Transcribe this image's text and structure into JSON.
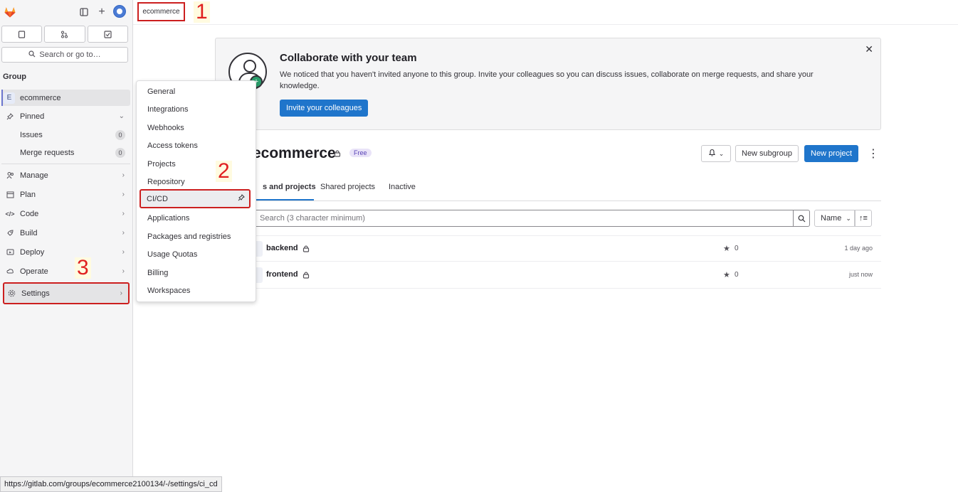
{
  "top": {
    "breadcrumb": "ecommerce",
    "annotations": [
      "1",
      "2",
      "3"
    ]
  },
  "sidebar": {
    "section_label": "Group",
    "search_label": "Search or go to…",
    "group_initial": "E",
    "group_name": "ecommerce",
    "pinned_label": "Pinned",
    "pinned_items": [
      {
        "label": "Issues",
        "count": "0"
      },
      {
        "label": "Merge requests",
        "count": "0"
      }
    ],
    "nav": [
      {
        "label": "Manage",
        "icon": "users-icon"
      },
      {
        "label": "Plan",
        "icon": "plan-icon"
      },
      {
        "label": "Code",
        "icon": "code-icon"
      },
      {
        "label": "Build",
        "icon": "rocket-icon"
      },
      {
        "label": "Deploy",
        "icon": "deploy-icon"
      },
      {
        "label": "Operate",
        "icon": "cloud-icon"
      },
      {
        "label": "Settings",
        "icon": "gear-icon"
      }
    ]
  },
  "settings_menu": {
    "items": [
      "General",
      "Integrations",
      "Webhooks",
      "Access tokens",
      "Projects",
      "Repository",
      "CI/CD",
      "Applications",
      "Packages and registries",
      "Usage Quotas",
      "Billing",
      "Workspaces"
    ],
    "highlighted": "CI/CD"
  },
  "banner": {
    "title": "Collaborate with your team",
    "text": "We noticed that you haven't invited anyone to this group. Invite your colleagues so you can discuss issues, collaborate on merge requests, and share your knowledge.",
    "button": "Invite your colleagues"
  },
  "group": {
    "title": "ecommerce",
    "badge": "Free",
    "new_subgroup": "New subgroup",
    "new_project": "New project"
  },
  "tabs": {
    "items": [
      "s and projects",
      "Shared projects",
      "Inactive"
    ],
    "active": "s and projects"
  },
  "filter": {
    "search_placeholder": "Search (3 character minimum)",
    "sort_label": "Name"
  },
  "projects": [
    {
      "name": "backend",
      "stars": "0",
      "updated": "1 day ago"
    },
    {
      "name": "frontend",
      "stars": "0",
      "updated": "just now"
    }
  ],
  "status_url": "https://gitlab.com/groups/ecommerce2100134/-/settings/ci_cd",
  "colors": {
    "primary": "#1f75cb",
    "annotation": "#cc1f1f",
    "badge_bg": "#e9e3f8",
    "sidebar_bg": "#f5f5f6"
  }
}
